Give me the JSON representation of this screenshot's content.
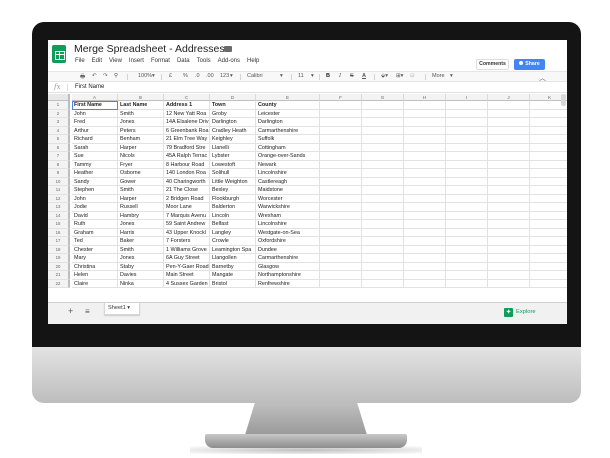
{
  "doc": {
    "title": "Merge Spreadsheet - Addresses",
    "menu": [
      "File",
      "Edit",
      "View",
      "Insert",
      "Format",
      "Data",
      "Tools",
      "Add-ons",
      "Help"
    ],
    "comments_label": "Comments",
    "share_label": "Share"
  },
  "toolbar": {
    "zoom": "100%",
    "currency": "£",
    "percent": "%",
    "dec_less": ".0",
    "dec_more": ".00",
    "number_format": "123",
    "font": "Calibri",
    "font_size": "11",
    "bold": "B",
    "italic": "I",
    "strike": "S",
    "text_color": "A",
    "more": "More"
  },
  "formula": {
    "fx": "fx",
    "value": "First Name"
  },
  "columns": [
    "A",
    "B",
    "C",
    "D",
    "E",
    "F",
    "G",
    "H",
    "I",
    "J",
    "K"
  ],
  "rows": [
    [
      "1",
      "First Name",
      "Last Name",
      "Address 1",
      "Town",
      "County"
    ],
    [
      "2",
      "John",
      "Smith",
      "12 New Yatt Roa",
      "Groby",
      "Leicester"
    ],
    [
      "3",
      "Fred",
      "Jones",
      "14A Elsalene Driv",
      "Darlington",
      "Darlington"
    ],
    [
      "4",
      "Arthur",
      "Peters",
      "6 Greenbank Roa",
      "Cradley Heath",
      "Carmarthenshire"
    ],
    [
      "5",
      "Richard",
      "Benham",
      "21 Elm Tree Way",
      "Keighley",
      "Suffolk"
    ],
    [
      "6",
      "Sarah",
      "Harper",
      "79 Bradford Stre",
      "Llanelli",
      "Cottingham"
    ],
    [
      "7",
      "Sue",
      "Nicols",
      "45A Ralph Terrac",
      "Lybster",
      "Orange-over-Sands"
    ],
    [
      "8",
      "Tammy",
      "Fryer",
      "8 Harbour Road",
      "Lowestoft",
      "Newark"
    ],
    [
      "9",
      "Heather",
      "Osborne",
      "140 London Roa",
      "Solihull",
      "Lincolnshire"
    ],
    [
      "10",
      "Sandy",
      "Gower",
      "40 Charingworth",
      "Little Weighton",
      "Castlereagh"
    ],
    [
      "11",
      "Stephen",
      "Smith",
      "21 The Close",
      "Bexley",
      "Maidstone"
    ],
    [
      "12",
      "John",
      "Harper",
      "2 Bridgen Road",
      "Flookburgh",
      "Worcester"
    ],
    [
      "13",
      "Jodie",
      "Russell",
      "Moor Lane",
      "Balderton",
      "Warwickshire"
    ],
    [
      "14",
      "David",
      "Hambry",
      "7 Marquis Avenu",
      "Lincoln",
      "Wrexham"
    ],
    [
      "15",
      "Ruth",
      "Jones",
      "59 Saint Andrew",
      "Belfast",
      "Lincolnshire"
    ],
    [
      "16",
      "Graham",
      "Harris",
      "43 Upper Knockl",
      "Langley",
      "Westgate-on-Sea"
    ],
    [
      "17",
      "Ted",
      "Baker",
      "7 Forsters",
      "Crowle",
      "Oxfordshire"
    ],
    [
      "18",
      "Chester",
      "Smith",
      "1 Williams Grove",
      "Leamington Spa",
      "Dundee"
    ],
    [
      "19",
      "Mary",
      "Jones",
      "6A Guy Street",
      "Llangollen",
      "Carmarthenshire"
    ],
    [
      "20",
      "Christina",
      "Staby",
      "Pen-Y-Gaer Road",
      "Barnetby",
      "Glasgow"
    ],
    [
      "21",
      "Helen",
      "Davies",
      "Main Street",
      "Mangate",
      "Northamptonshire"
    ],
    [
      "22",
      "Claire",
      "Ninka",
      "4 Sussex Garden",
      "Bristol",
      "Renfrewshire"
    ]
  ],
  "sheet_tab": "Sheet1",
  "explore_label": "Explore",
  "colors": {
    "sheets_green": "#0f9d58",
    "share_blue": "#4285f4"
  }
}
